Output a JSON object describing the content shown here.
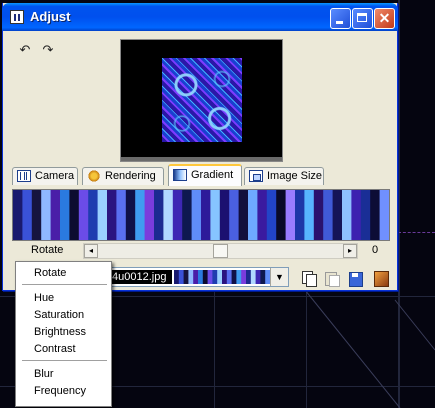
{
  "window": {
    "title": "Adjust",
    "controls": [
      "minimize-icon",
      "maximize-icon",
      "close-icon"
    ],
    "close_glyph": "✕"
  },
  "toolbar": {
    "undo_icon": "undo-icon",
    "redo_icon": "redo-icon",
    "undo_glyph": "↶",
    "redo_glyph": "↷"
  },
  "tabs": [
    {
      "label": "Camera",
      "icon": "camera-icon",
      "active": false
    },
    {
      "label": "Rendering",
      "icon": "rendering-icon",
      "active": false
    },
    {
      "label": "Gradient",
      "icon": "gradient-icon",
      "active": true
    },
    {
      "label": "Image Size",
      "icon": "image-size-icon",
      "active": false
    }
  ],
  "gradient": {
    "colors": [
      "#1a1a6e",
      "#3a52d8",
      "#16143f",
      "#8fb8ff",
      "#4a1ea8",
      "#2a7ae0",
      "#0c0c30",
      "#6b4ce8",
      "#1f3db0",
      "#9ad0ff",
      "#2b1480",
      "#5a6ff0",
      "#101048",
      "#3f9bf0",
      "#7a3cdc",
      "#1c2a90",
      "#b0d8ff",
      "#3d27b4",
      "#0e1850",
      "#5f8cf8",
      "#2d1a9a",
      "#86c4ff",
      "#1b1070",
      "#4a60e0",
      "#120e3c",
      "#6ea8ff",
      "#3a1aa0",
      "#2244c8",
      "#0a0a28",
      "#9a7cff",
      "#1e36a8",
      "#58b4ff",
      "#2a126e",
      "#405ad8",
      "#151458",
      "#8ec0ff",
      "#3c22b0",
      "#1a2e96",
      "#0d0d36",
      "#7090ff"
    ]
  },
  "rotate": {
    "label": "Rotate",
    "value": "0",
    "slider_value": 0,
    "slider_min": -180,
    "slider_max": 180,
    "left_arrow": "◂",
    "right_arrow": "▸"
  },
  "file": {
    "name": "4u0012.jpg",
    "drop_glyph": "▼",
    "actions": [
      "copy-icon",
      "paste-icon",
      "save-icon",
      "palette-icon"
    ]
  },
  "context_menu": {
    "items": [
      "Rotate",
      "Hue",
      "Saturation",
      "Brightness",
      "Contrast",
      "Blur",
      "Frequency"
    ]
  },
  "colors": {
    "titlebar": "#0054e3",
    "window_bg": "#ece9d8",
    "tab_highlight": "#ffc83c",
    "desktop": "#050510"
  }
}
